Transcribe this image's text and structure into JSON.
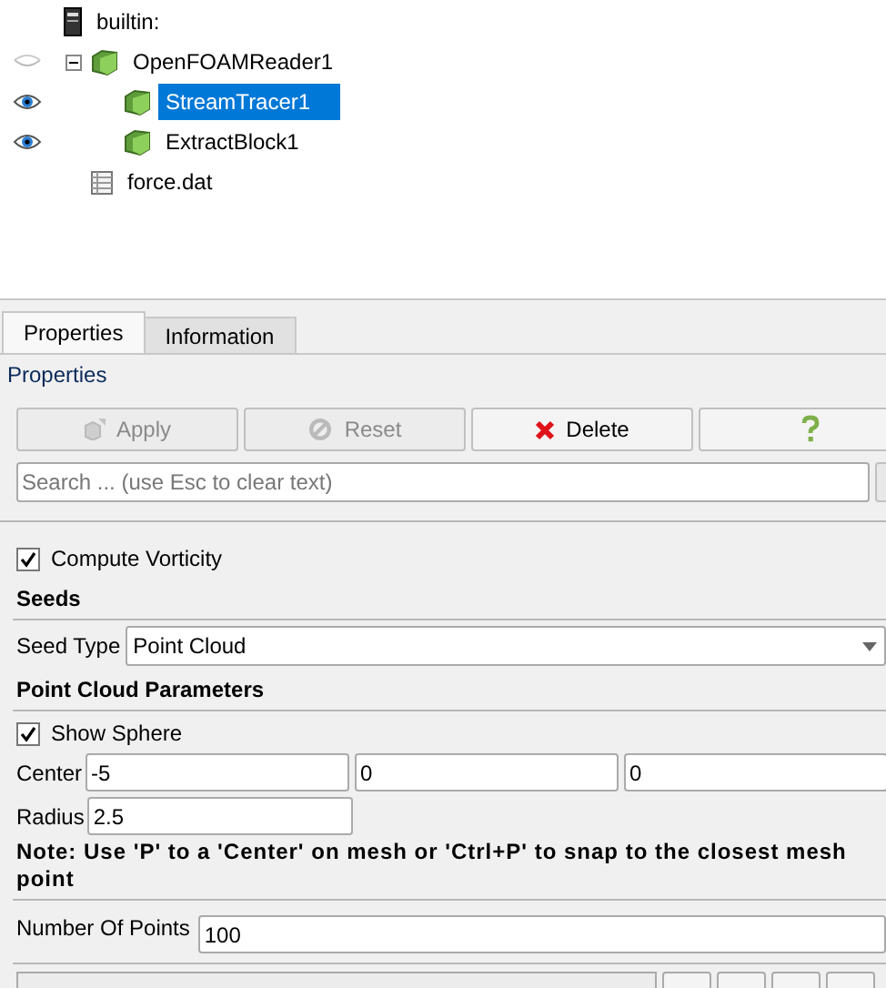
{
  "pipeline": [
    {
      "label": "builtin:",
      "kind": "server",
      "selected": false,
      "children": [
        {
          "label": "OpenFOAMReader1",
          "kind": "source",
          "visible": false,
          "expanded": true,
          "selected": false,
          "children": [
            {
              "label": "StreamTracer1",
              "kind": "source",
              "visible": true,
              "selected": true
            },
            {
              "label": "ExtractBlock1",
              "kind": "source",
              "visible": true,
              "selected": false
            }
          ]
        },
        {
          "label": "force.dat",
          "kind": "table",
          "selected": false
        }
      ]
    }
  ],
  "tabs": [
    {
      "label": "Properties",
      "selected": true
    },
    {
      "label": "Information",
      "selected": false
    }
  ],
  "panel_title": "Properties",
  "buttons": [
    {
      "label": "Apply",
      "kind": "apply",
      "disabled": true
    },
    {
      "label": "Reset",
      "kind": "reset",
      "disabled": true
    },
    {
      "label": "Delete",
      "kind": "delete",
      "disabled": false
    },
    {
      "kind": "help",
      "disabled": false
    }
  ],
  "search": {
    "placeholder": "Search ... (use Esc to clear text)"
  },
  "compute_vorticity": {
    "label": "Compute Vorticity",
    "checked": true
  },
  "seeds": {
    "heading": "Seeds",
    "seed_type_label": "Seed Type",
    "seed_type": "Point Cloud"
  },
  "point_cloud": {
    "heading": "Point Cloud Parameters",
    "show_sphere": {
      "label": "Show Sphere",
      "checked": true
    },
    "center_label": "Center",
    "center": [
      "-5",
      "0",
      "0"
    ],
    "radius_label": "Radius",
    "radius": "2.5",
    "note": "Note: Use 'P' to a 'Center' on mesh or 'Ctrl+P' to snap to the closest mesh point",
    "points_label": "Number Of Points",
    "points": "100"
  }
}
